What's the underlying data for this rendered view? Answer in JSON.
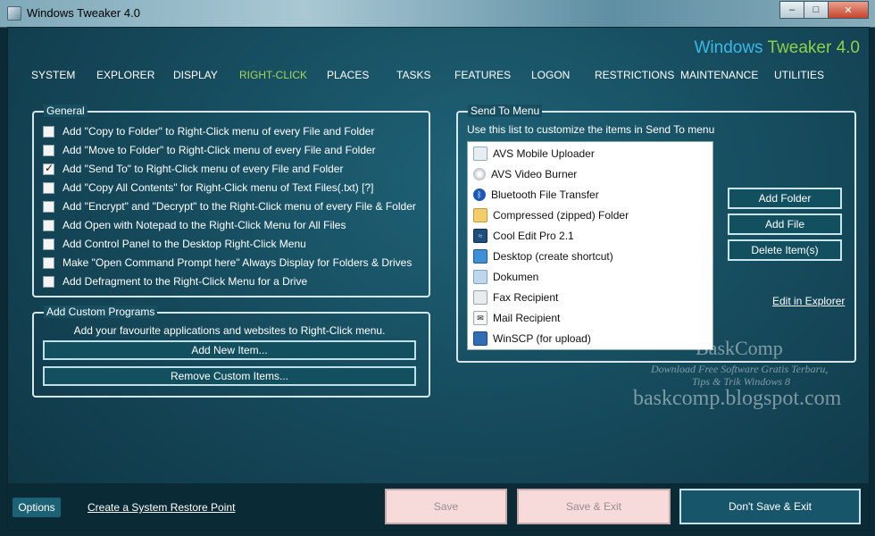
{
  "window": {
    "title": "Windows Tweaker 4.0",
    "minimize": "–",
    "maximize": "□",
    "close": "✕"
  },
  "brand": {
    "part1": "Windows",
    "part2": "Tweaker 4.0"
  },
  "nav": {
    "active": "RIGHT-CLICK",
    "items": [
      "SYSTEM",
      "EXPLORER",
      "DISPLAY",
      "RIGHT-CLICK",
      "PLACES",
      "TASKS",
      "FEATURES",
      "LOGON",
      "RESTRICTIONS",
      "MAINTENANCE",
      "UTILITIES"
    ]
  },
  "general": {
    "title": "General",
    "options": [
      {
        "label": "Add \"Copy to Folder\" to Right-Click menu of every File and Folder",
        "checked": false
      },
      {
        "label": "Add \"Move to Folder\" to Right-Click menu of every File and Folder",
        "checked": false
      },
      {
        "label": "Add \"Send To\" to Right-Click menu of every File and Folder",
        "checked": true
      },
      {
        "label": "Add \"Copy All Contents\" for Right-Click menu of Text Files(.txt) [?]",
        "checked": false
      },
      {
        "label": "Add \"Encrypt\" and \"Decrypt\" to the Right-Click menu of every File & Folder",
        "checked": false
      },
      {
        "label": "Add Open with Notepad to the Right-Click Menu for All Files",
        "checked": false
      },
      {
        "label": "Add Control Panel to the Desktop Right-Click Menu",
        "checked": false
      },
      {
        "label": "Make \"Open Command Prompt here\" Always Display for Folders & Drives",
        "checked": false
      },
      {
        "label": "Add Defragment to the Right-Click Menu for a Drive",
        "checked": false
      }
    ]
  },
  "custom": {
    "title": "Add Custom Programs",
    "note": "Add your favourite applications and websites to Right-Click menu.",
    "add_button": "Add New Item...",
    "remove_button": "Remove Custom Items..."
  },
  "sendto": {
    "title": "Send To Menu",
    "description": "Use this list to customize the items in Send To menu",
    "items": [
      {
        "label": "AVS Mobile Uploader",
        "icon": "avs-icon"
      },
      {
        "label": "AVS Video Burner",
        "icon": "disc-icon"
      },
      {
        "label": "Bluetooth File Transfer",
        "icon": "bluetooth-icon"
      },
      {
        "label": "Compressed (zipped) Folder",
        "icon": "zip-folder-icon"
      },
      {
        "label": "Cool Edit Pro 2.1",
        "icon": "cooledit-icon"
      },
      {
        "label": "Desktop (create shortcut)",
        "icon": "desktop-icon"
      },
      {
        "label": "Dokumen",
        "icon": "documents-icon"
      },
      {
        "label": "Fax Recipient",
        "icon": "fax-icon"
      },
      {
        "label": "Mail Recipient",
        "icon": "mail-icon"
      },
      {
        "label": "WinSCP (for upload)",
        "icon": "winscp-icon"
      }
    ],
    "add_folder": "Add Folder",
    "add_file": "Add File",
    "delete_items": "Delete Item(s)",
    "edit_link": "Edit in Explorer"
  },
  "watermark": {
    "name": "BaskComp",
    "line1": "Download Free Software Gratis Terbaru,",
    "line2": "Tips & Trik Windows 8",
    "url": "baskcomp.blogspot.com"
  },
  "bottom": {
    "options": "Options",
    "restore_link": "Create a System Restore Point",
    "save": "Save",
    "save_exit": "Save & Exit",
    "dont_save": "Don't Save & Exit"
  }
}
